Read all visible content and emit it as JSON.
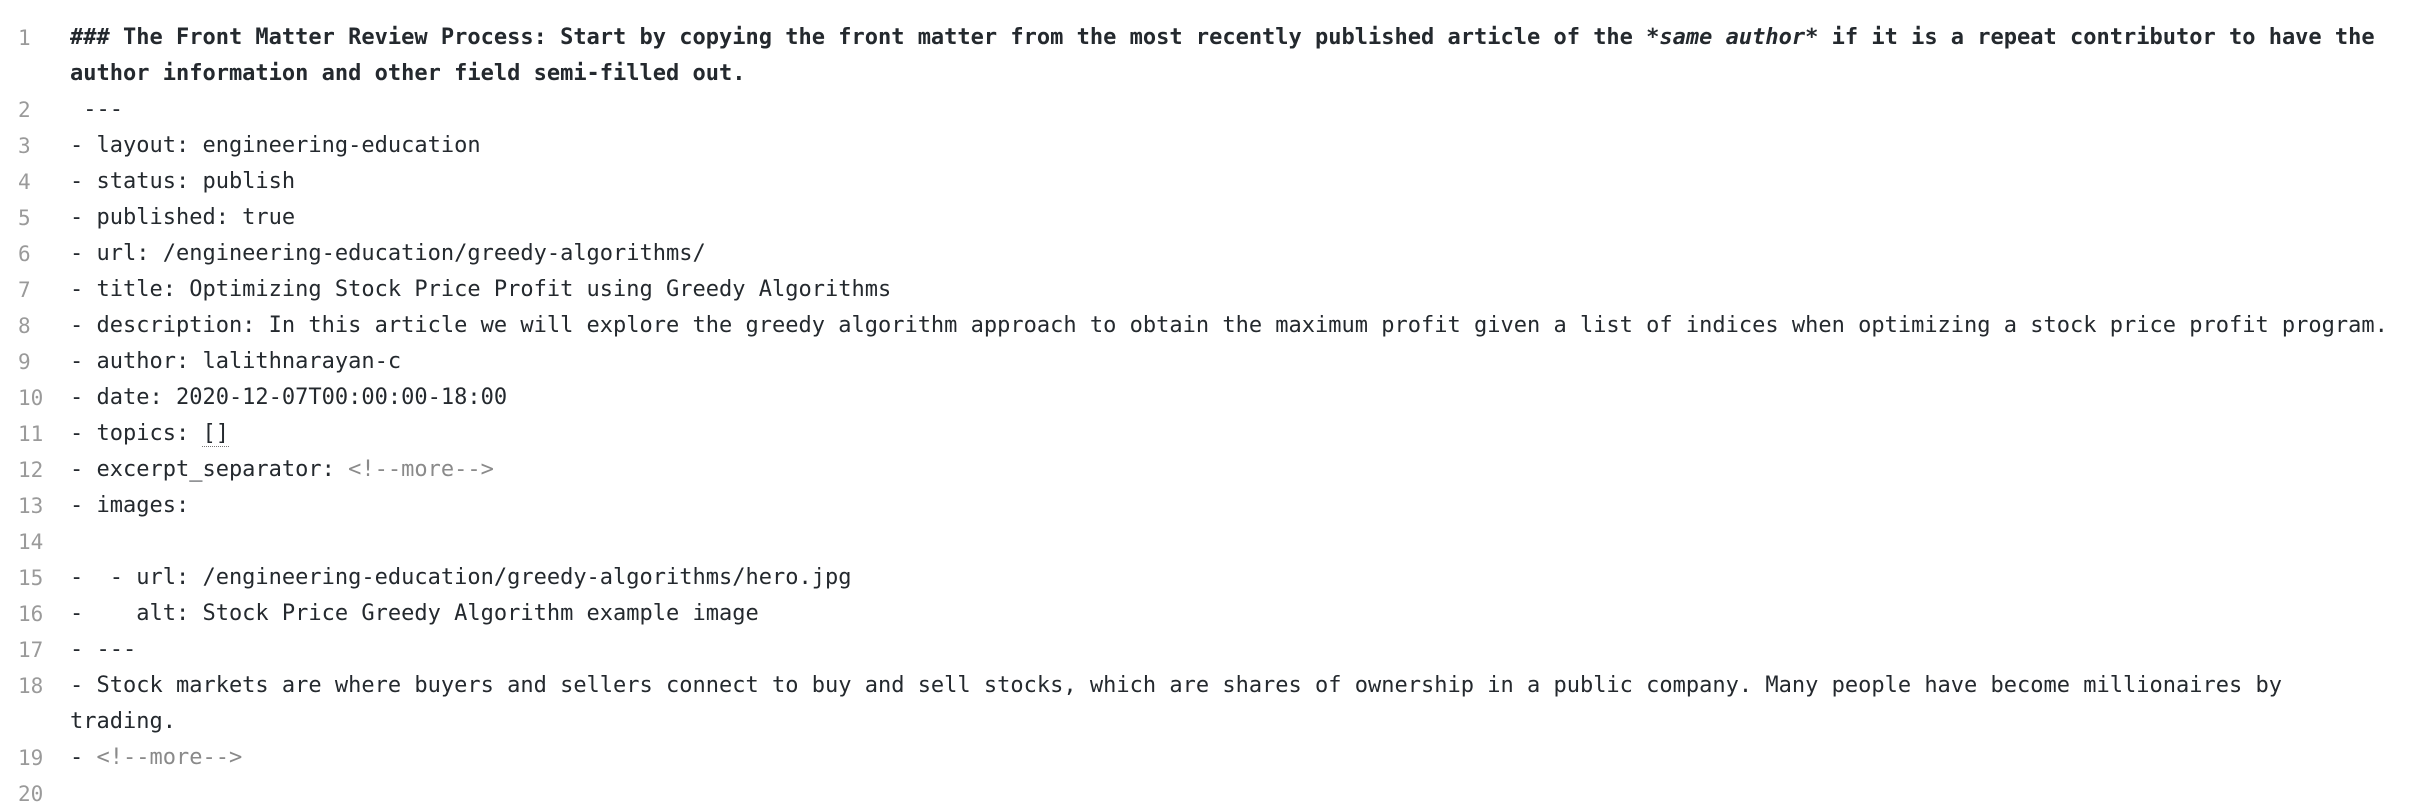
{
  "lines": [
    {
      "num": "1",
      "heading_pre": "### The Front Matter Review Process: Start by copying the front matter from the most recently published article of the ",
      "heading_em": "*same author*",
      "heading_post": " if it is a repeat contributor to have the author information and other field semi-filled out."
    },
    {
      "num": "2",
      "text": " ---"
    },
    {
      "num": "3",
      "text": "- layout: engineering-education"
    },
    {
      "num": "4",
      "text": "- status: publish"
    },
    {
      "num": "5",
      "text": "- published: true"
    },
    {
      "num": "6",
      "text": "- url: /engineering-education/greedy-algorithms/"
    },
    {
      "num": "7",
      "text": "- title: Optimizing Stock Price Profit using Greedy Algorithms"
    },
    {
      "num": "8",
      "text": "- description: In this article we will explore the greedy algorithm approach to obtain the maximum profit given a list of indices when optimizing a stock price profit program."
    },
    {
      "num": "9",
      "text": "- author: lalithnarayan-c"
    },
    {
      "num": "10",
      "text": "- date: 2020-12-07T00:00:00-18:00"
    },
    {
      "num": "11",
      "prefix": "- topics: ",
      "brackets": "[]"
    },
    {
      "num": "12",
      "prefix": "- excerpt_separator: ",
      "comment": "<!--more-->"
    },
    {
      "num": "13",
      "text": "- images:"
    },
    {
      "num": "14",
      "text": ""
    },
    {
      "num": "15",
      "text": "-  - url: /engineering-education/greedy-algorithms/hero.jpg"
    },
    {
      "num": "16",
      "text": "-    alt: Stock Price Greedy Algorithm example image"
    },
    {
      "num": "17",
      "text": "- ---"
    },
    {
      "num": "18",
      "text": "- Stock markets are where buyers and sellers connect to buy and sell stocks, which are shares of ownership in a public company. Many people have become millionaires by trading."
    },
    {
      "num": "19",
      "prefix": "- ",
      "comment": "<!--more-->"
    },
    {
      "num": "20",
      "text": ""
    }
  ]
}
